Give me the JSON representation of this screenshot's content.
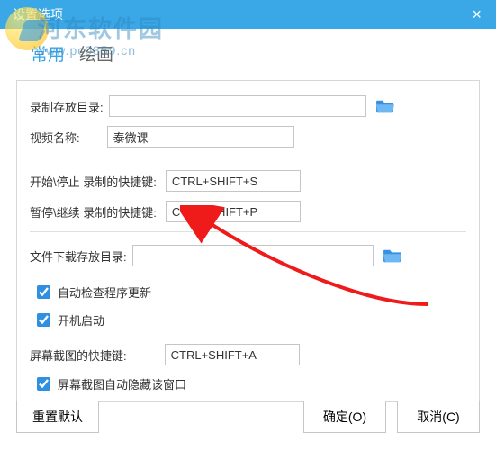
{
  "watermark": {
    "text1": "河东软件园",
    "text2": "www.pc0359.cn"
  },
  "window": {
    "title": "设置选项",
    "close": "×"
  },
  "tabs": {
    "general": "常用",
    "draw": "绘画"
  },
  "labels": {
    "record_dir": "录制存放目录:",
    "video_name": "视频名称:",
    "hotkey_start_stop": "开始\\停止 录制的快捷键:",
    "hotkey_pause_resume": "暂停\\继续 录制的快捷键:",
    "download_dir": "文件下载存放目录:",
    "chk_auto_update": "自动检查程序更新",
    "chk_autostart": "开机启动",
    "hotkey_screenshot": "屏幕截图的快捷键:",
    "chk_screenshot_hide": "屏幕截图自动隐藏该窗口"
  },
  "values": {
    "record_dir": "",
    "video_name": "泰微课",
    "hotkey_start_stop": "CTRL+SHIFT+S",
    "hotkey_pause_resume": "CTRL+SHIFT+P",
    "download_dir": "",
    "hotkey_screenshot": "CTRL+SHIFT+A",
    "chk_auto_update": true,
    "chk_autostart": true,
    "chk_screenshot_hide": true
  },
  "buttons": {
    "reset": "重置默认",
    "ok": "确定(O)",
    "cancel": "取消(C)"
  },
  "colors": {
    "accent": "#3aa7e6",
    "folder": "#3a8fe0"
  }
}
